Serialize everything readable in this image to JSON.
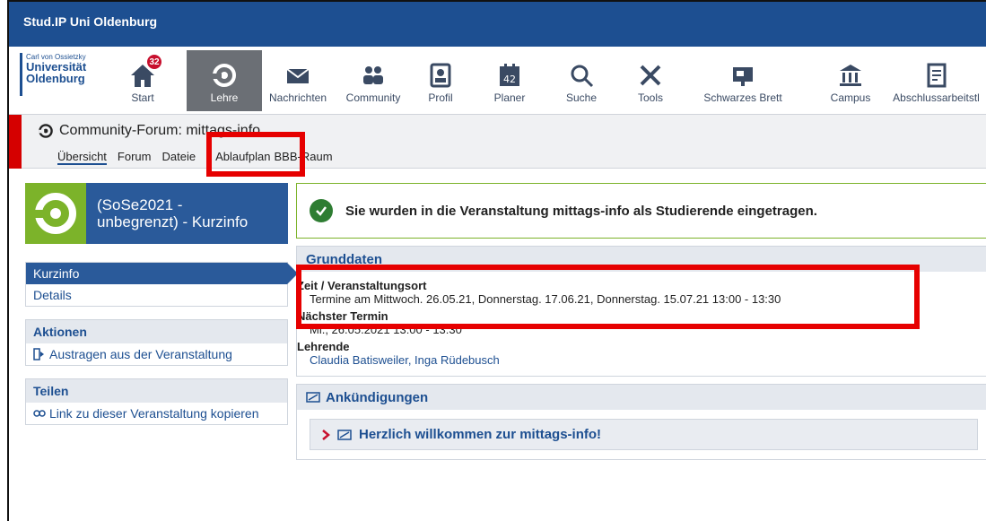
{
  "app_title": "Stud.IP Uni Oldenburg",
  "logo": {
    "line1": "Carl von Ossietzky",
    "line2": "Universität",
    "line3": "Oldenburg"
  },
  "nav": {
    "items": [
      {
        "label": "Start",
        "icon": "home-icon",
        "badge": "32"
      },
      {
        "label": "Lehre",
        "icon": "lehre-icon",
        "active": true
      },
      {
        "label": "Nachrichten",
        "icon": "mail-icon"
      },
      {
        "label": "Community",
        "icon": "people-icon"
      },
      {
        "label": "Profil",
        "icon": "profile-icon"
      },
      {
        "label": "Planer",
        "icon": "calendar-icon"
      },
      {
        "label": "Suche",
        "icon": "search-icon"
      },
      {
        "label": "Tools",
        "icon": "tools-icon"
      },
      {
        "label": "Schwarzes Brett",
        "icon": "board-icon"
      },
      {
        "label": "Campus",
        "icon": "campus-icon"
      },
      {
        "label": "Abschlussarbeitstl",
        "icon": "document-icon"
      }
    ],
    "badge_count": "32"
  },
  "context": {
    "title": "Community-Forum: mittags-info",
    "tabs": [
      "Übersicht",
      "Forum",
      "Dateie",
      "Ablaufplan",
      "BBB-Raum"
    ]
  },
  "sidebar": {
    "course_title_line1": "(SoSe2021 -",
    "course_title_line2": "unbegrenzt) - Kurzinfo",
    "nav_items": [
      "Kurzinfo",
      "Details"
    ],
    "actions_head": "Aktionen",
    "actions_item": "Austragen aus der Veranstaltung",
    "share_head": "Teilen",
    "share_item": "Link zu dieser Veranstaltung kopieren"
  },
  "message": "Sie wurden in die Veranstaltung mittags-info als Studierende eingetragen.",
  "grunddaten": {
    "head": "Grunddaten",
    "zeit_label": "Zeit / Veranstaltungsort",
    "zeit_value": "Termine am Mittwoch. 26.05.21, Donnerstag. 17.06.21, Donnerstag. 15.07.21 13:00 - 13:30",
    "naechster_label": "Nächster Termin",
    "naechster_value": "Mi., 26.05.2021 13:00 - 13:30",
    "lehrende_label": "Lehrende",
    "lehrende_value": "Claudia Batisweiler, Inga Rüdebusch"
  },
  "ankuendigungen": {
    "head": "Ankündigungen",
    "item": "Herzlich willkommen zur mittags-info!"
  },
  "colors": {
    "brand_blue": "#1d4f91",
    "highlight_red": "#e60000",
    "success_green": "#2e7d32",
    "course_green": "#7cb32a"
  }
}
